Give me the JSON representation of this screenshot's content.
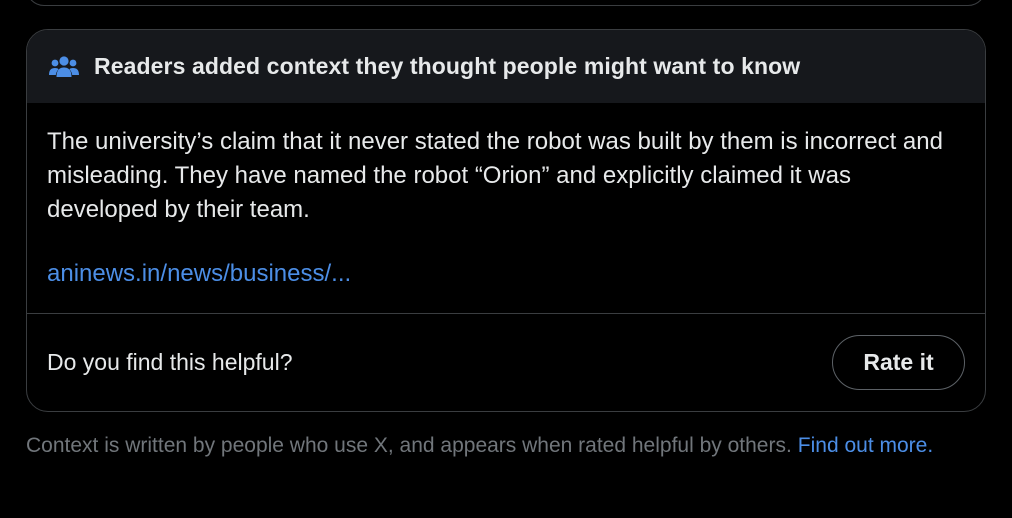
{
  "note": {
    "header_title": "Readers added context they thought people might want to know",
    "header_icon": "people-icon",
    "body_text": "The university’s claim that it never stated the robot was built by them is incorrect and misleading. They have named the robot “Orion” and explicitly claimed it was developed by their team.",
    "source_link": "aninews.in/news/business/...",
    "helpful_question": "Do you find this helpful?",
    "rate_button_label": "Rate it"
  },
  "footer": {
    "disclaimer": "Context is written by people who use X, and appears when rated helpful by others.",
    "learn_more_link": "Find out more."
  },
  "colors": {
    "background": "#000000",
    "header_bg": "#16181c",
    "border": "#3a3d40",
    "text": "#e7e9ea",
    "muted_text": "#71767b",
    "link": "#4c8ee6"
  }
}
